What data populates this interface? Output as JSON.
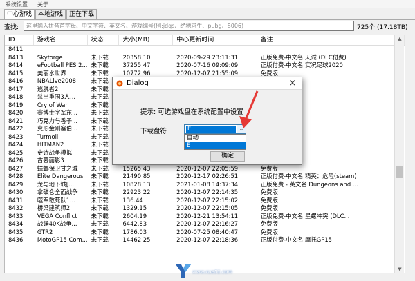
{
  "menu": [
    "系统设置",
    "关于"
  ],
  "tabs": [
    {
      "label": "中心游戏",
      "active": true
    },
    {
      "label": "本地游戏",
      "active": false
    },
    {
      "label": "正在下载",
      "active": false
    }
  ],
  "search": {
    "label": "查找:",
    "placeholder": "这里输入拼音首字母、中文字符、英文名、游戏编号(例:jdqs、绝地求生、pubg、8006)",
    "count": "725个 (17.18TB)"
  },
  "table": {
    "headers": [
      "ID",
      "游戏名",
      "状态",
      "大小(MB)",
      "中心更新时间",
      "备注"
    ],
    "rows": [
      [
        "8411",
        "",
        "",
        "",
        "",
        ""
      ],
      [
        "8413",
        "Skyforge",
        "未下载",
        "20358.10",
        "2020-09-29 23:11:31",
        "正版免费-中文名 天诚 (DLC付费)"
      ],
      [
        "8414",
        "eFootball PES 2...",
        "未下载",
        "37255.47",
        "2020-07-16 09:09:09",
        "正版付费-中文名 实况足球2020"
      ],
      [
        "8415",
        "美丽水世界",
        "未下载",
        "10772.96",
        "2020-12-07 21:55:09",
        "免费版"
      ],
      [
        "8416",
        "NBALive2008",
        "未下载",
        "",
        "",
        ""
      ],
      [
        "8417",
        "逃脱者2",
        "未下载",
        "",
        "",
        ""
      ],
      [
        "8418",
        "杀出重围3人...",
        "未下载",
        "",
        "",
        ""
      ],
      [
        "8419",
        "Cry of War",
        "未下载",
        "",
        "",
        "名 战争号角"
      ],
      [
        "8420",
        "赛博士字军东...",
        "未下载",
        "",
        "",
        ""
      ],
      [
        "8421",
        "巧克力与香子...",
        "未下载",
        "",
        "",
        ""
      ],
      [
        "8422",
        "变形金刚塞伯...",
        "未下载",
        "",
        "",
        ""
      ],
      [
        "8423",
        "Turmoil",
        "未下载",
        "",
        "",
        "名 石油大亨"
      ],
      [
        "8424",
        "HITMAN2",
        "未下载",
        "",
        "",
        "名 杀手2"
      ],
      [
        "8425",
        "史诗战争模拟",
        "未下载",
        "",
        "",
        ""
      ],
      [
        "8426",
        "古墓丽影3",
        "未下载",
        "",
        "",
        ""
      ],
      [
        "8427",
        "蟑螂保卫甘之城",
        "未下载",
        "15265.43",
        "2020-12-07 22:05:59",
        "免费版"
      ],
      [
        "8428",
        "Elite Dangerous",
        "未下载",
        "21490.85",
        "2020-12-17 02:26:51",
        "正版付费-中文名 精英：危险(steam)"
      ],
      [
        "8429",
        "龙与地下城[...",
        "未下载",
        "10828.13",
        "2021-01-08 14:37:34",
        "正版免费 - 英文名 Dungeons and ..."
      ],
      [
        "8430",
        "拿破仑全面战争",
        "未下载",
        "22923.22",
        "2020-12-07 22:14:35",
        "免费版"
      ],
      [
        "8431",
        "噬军敢死队1...",
        "未下载",
        "136.44",
        "2020-12-07 22:15:02",
        "免费版"
      ],
      [
        "8432",
        "桥梁建筑师2",
        "未下载",
        "1329.15",
        "2020-12-07 22:15:05",
        "免费版"
      ],
      [
        "8433",
        "VEGA Conflict",
        "未下载",
        "2604.19",
        "2020-12-21 13:54:11",
        "正版免费-中文名 星螺冲突 (DLC..."
      ],
      [
        "8434",
        "战锤40K战争...",
        "未下载",
        "6442.83",
        "2020-12-07 22:16:27",
        "免费版"
      ],
      [
        "8435",
        "GTR2",
        "未下载",
        "1786.03",
        "2020-07-25 08:40:47",
        "免费版"
      ],
      [
        "8436",
        "MotoGP15 Com...",
        "未下载",
        "14462.25",
        "2020-12-07 22:18:36",
        "正版付费-中文名 摩托GP15"
      ]
    ]
  },
  "dialog": {
    "title": "Dialog",
    "hint": "提示: 可选游戏盘在系统配置中设置",
    "download_disk_label": "下载盘符",
    "selected_value": "E",
    "options": [
      "自动",
      "E"
    ],
    "ok_label": "确定"
  },
  "watermark": {
    "text": "www.xue51.com"
  },
  "colors": {
    "selection": "#0078d7",
    "arrow": "#e53935",
    "background": "#f0f0f0"
  }
}
